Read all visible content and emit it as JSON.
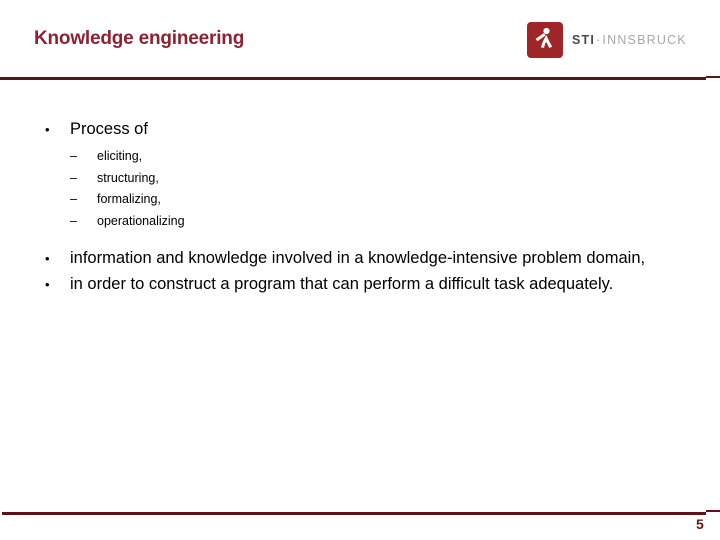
{
  "slide": {
    "title": "Knowledge engineering",
    "page_number": "5",
    "accent_color": "#8C2331",
    "rule_color": "#5C1414",
    "logo_color": "#9E2528"
  },
  "logo": {
    "mark_name": "sti-innsbruck-figure-logo",
    "text_primary": "STI",
    "separator": "·",
    "text_secondary": "INNSBRUCK"
  },
  "content": {
    "bullets": [
      {
        "marker": "•",
        "text": "Process of",
        "sub_marker": "–",
        "sub_items": [
          "eliciting,",
          "structuring,",
          "formalizing,",
          "operationalizing"
        ]
      },
      {
        "marker": "•",
        "text": "information and knowledge involved in a knowledge-intensive problem domain,"
      },
      {
        "marker": "•",
        "text": "in order to construct a program that can perform a difficult task adequately."
      }
    ]
  }
}
